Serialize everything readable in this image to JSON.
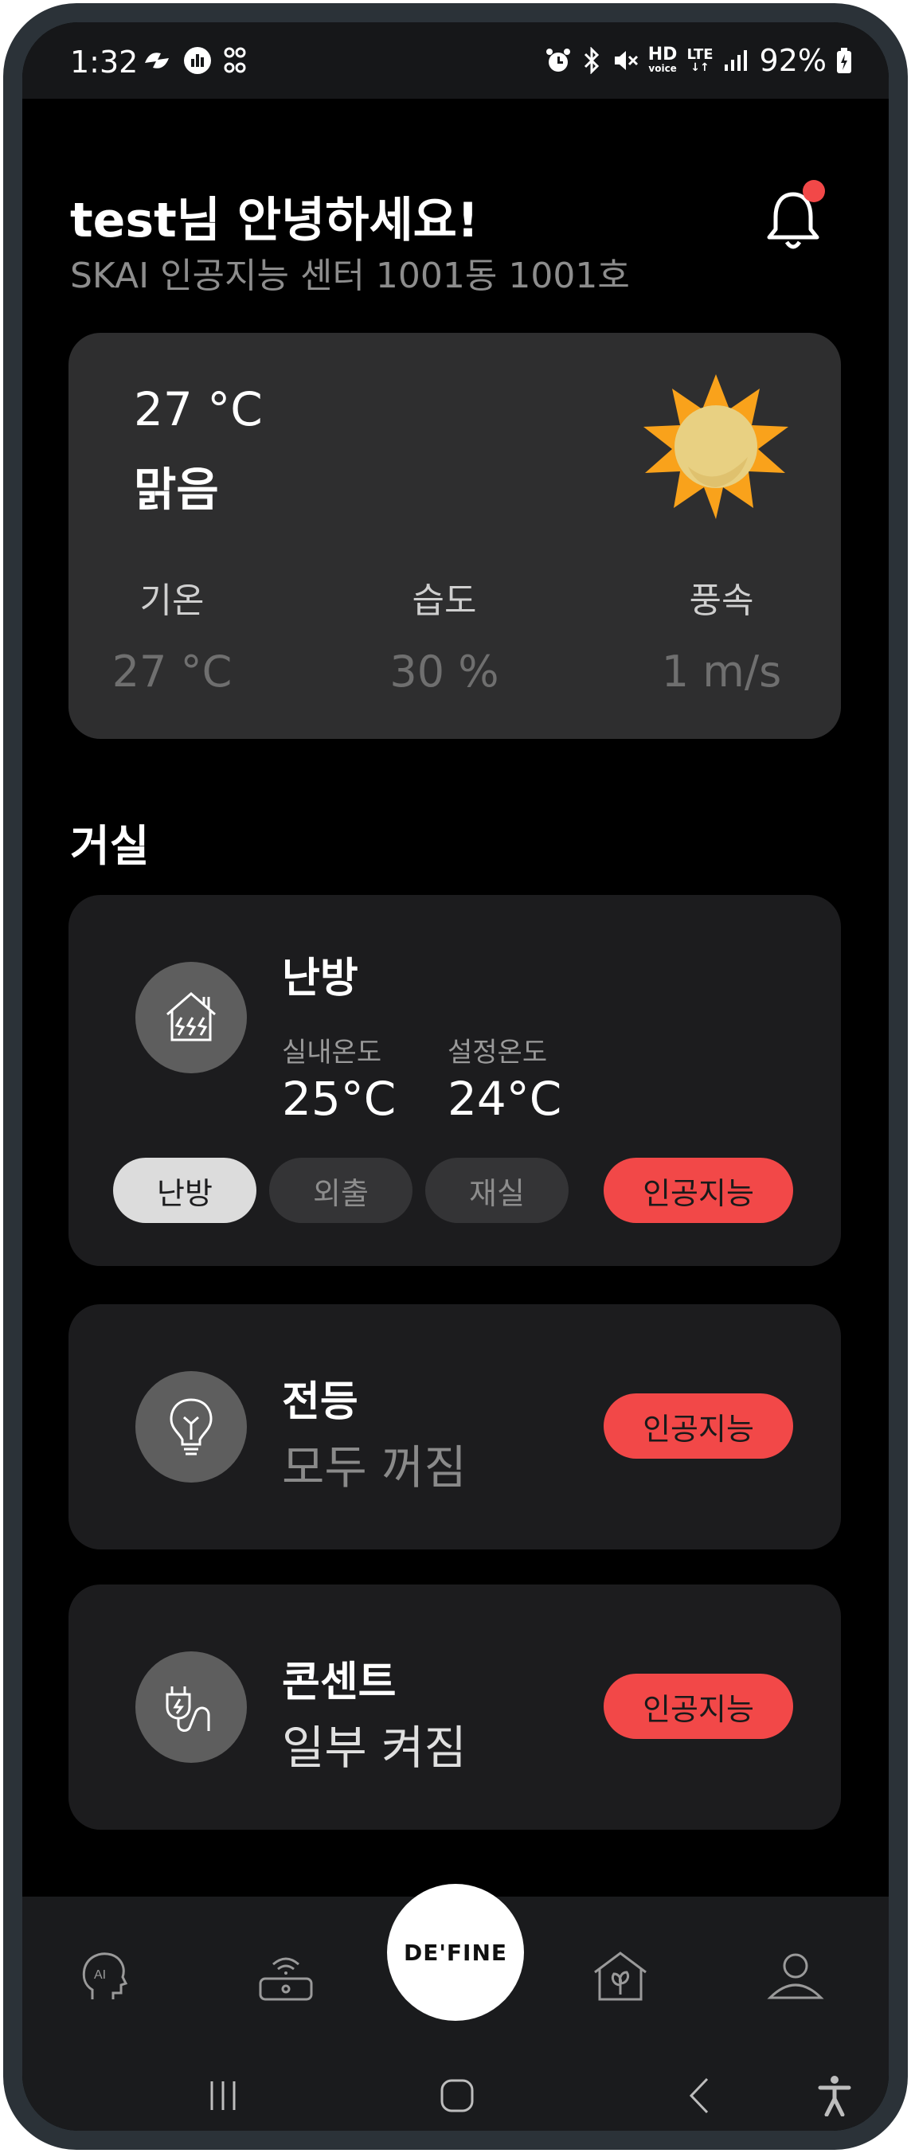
{
  "status_bar": {
    "time": "1:32",
    "battery": "92%",
    "hd_label": "HD",
    "voice_label": "voice",
    "lte_label": "LTE"
  },
  "header": {
    "greeting": "test님 안녕하세요!",
    "address": "SKAI 인공지능 센터 1001동 1001호",
    "has_notification": true
  },
  "weather": {
    "temperature": "27 °C",
    "condition": "맑음",
    "icon": "sun-icon",
    "stats": [
      {
        "label": "기온",
        "value": "27 °C"
      },
      {
        "label": "습도",
        "value": "30 %"
      },
      {
        "label": "풍속",
        "value": "1 m/s"
      }
    ]
  },
  "room": {
    "title": "거실"
  },
  "heating": {
    "title": "난방",
    "icon": "heating-house-icon",
    "indoor_label": "실내온도",
    "indoor_value": "25°C",
    "set_label": "설정온도",
    "set_value": "24°C",
    "modes": [
      {
        "label": "난방",
        "selected": true
      },
      {
        "label": "외출",
        "selected": false
      },
      {
        "label": "재실",
        "selected": false
      }
    ],
    "ai_label": "인공지능"
  },
  "light": {
    "title": "전등",
    "status": "모두 꺼짐",
    "icon": "lightbulb-icon",
    "ai_label": "인공지능"
  },
  "outlet": {
    "title": "콘센트",
    "status": "일부 켜짐",
    "icon": "plug-icon",
    "ai_label": "인공지능"
  },
  "bottom_nav": {
    "center_label": "DE'FINE",
    "items": [
      "ai-head-icon",
      "wifi-router-icon",
      "eco-home-icon",
      "profile-icon"
    ]
  },
  "colors": {
    "accent": "#f24848",
    "card": "#1c1c1e",
    "weather_card": "#2e2e2f",
    "background": "#000000"
  }
}
